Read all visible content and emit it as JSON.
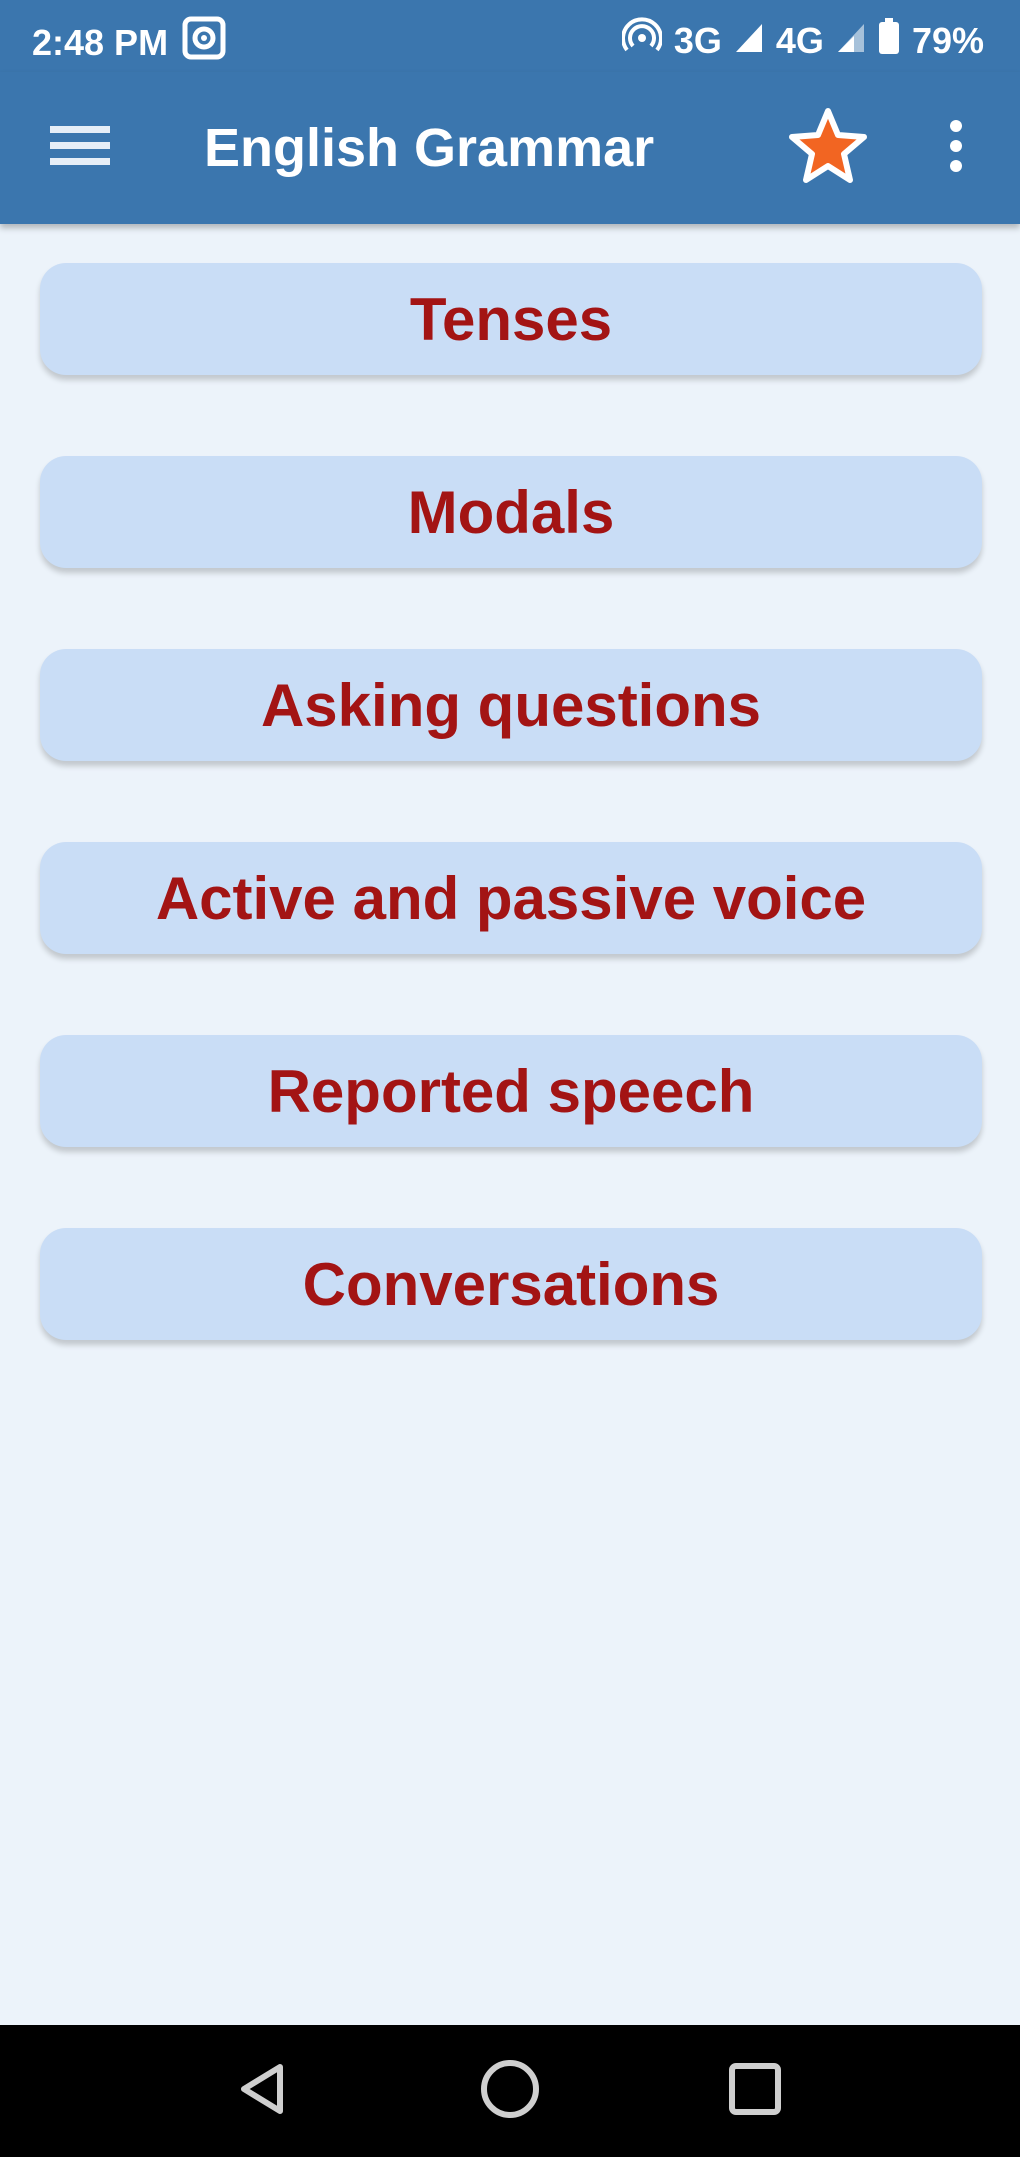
{
  "status_bar": {
    "time": "2:48 PM",
    "network_3g": "3G",
    "network_4g": "4G",
    "battery": "79%",
    "icons": [
      "screen-record-icon",
      "hotspot-icon",
      "signal-icon",
      "battery-icon"
    ]
  },
  "toolbar": {
    "title": "English Grammar",
    "icons": [
      "menu-icon",
      "star-icon",
      "more-vert-icon"
    ],
    "colors": {
      "background": "#3b76ae",
      "star_fill": "#f26522"
    }
  },
  "topics": [
    {
      "label": "Tenses"
    },
    {
      "label": "Modals"
    },
    {
      "label": "Asking questions"
    },
    {
      "label": "Active and passive voice"
    },
    {
      "label": "Reported speech"
    },
    {
      "label": "Conversations"
    }
  ],
  "colors": {
    "page_background": "#ecf3fa",
    "button_background": "#c9ddf6",
    "button_text": "#a31414"
  },
  "nav_bar": {
    "icons": [
      "back-icon",
      "home-icon",
      "recents-icon"
    ]
  }
}
